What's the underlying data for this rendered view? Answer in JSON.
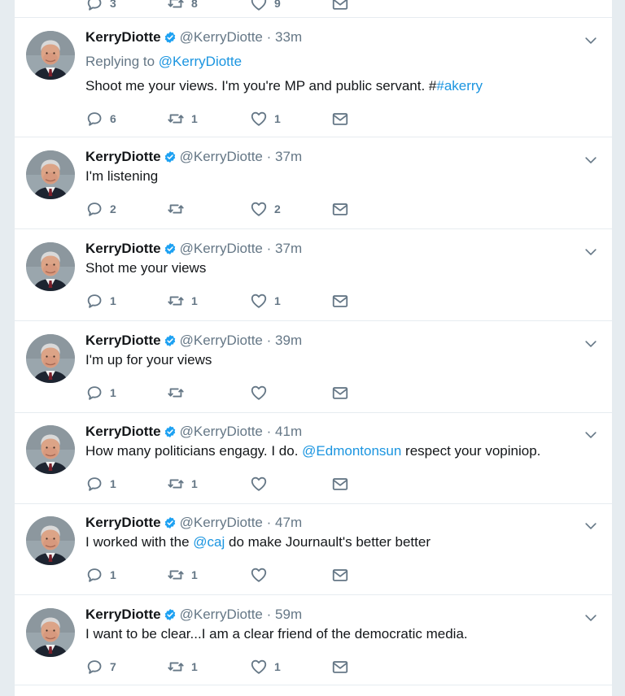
{
  "colors": {
    "link": "#1b95e0",
    "muted": "#657786",
    "verified": "#1da1f2",
    "text": "#14171a",
    "background": "#e6ecf0"
  },
  "partial_tweet": {
    "reply_count": "3",
    "retweet_count": "8",
    "like_count": "9"
  },
  "tweets": [
    {
      "name": "KerryDiotte",
      "handle": "@KerryDiotte",
      "separator": "·",
      "time": "33m",
      "replying_label": "Replying to",
      "replying_handle": "@KerryDiotte",
      "text": "Shoot me your views. I'm you're MP and public servant. #",
      "text_link": "#akerry",
      "text_after": "",
      "reply_count": "6",
      "retweet_count": "1",
      "like_count": "1"
    },
    {
      "name": "KerryDiotte",
      "handle": "@KerryDiotte",
      "separator": "·",
      "time": "37m",
      "text": "I'm listening",
      "text_link": "",
      "text_after": "",
      "reply_count": "2",
      "retweet_count": "",
      "like_count": "2"
    },
    {
      "name": "KerryDiotte",
      "handle": "@KerryDiotte",
      "separator": "·",
      "time": "37m",
      "text": "Shot me your views",
      "text_link": "",
      "text_after": "",
      "reply_count": "1",
      "retweet_count": "1",
      "like_count": "1"
    },
    {
      "name": "KerryDiotte",
      "handle": "@KerryDiotte",
      "separator": "·",
      "time": "39m",
      "text": "I'm up for your views",
      "text_link": "",
      "text_after": "",
      "reply_count": "1",
      "retweet_count": "",
      "like_count": ""
    },
    {
      "name": "KerryDiotte",
      "handle": "@KerryDiotte",
      "separator": "·",
      "time": "41m",
      "text": "How many politicians engagy. I do. ",
      "text_link": "@Edmontonsun",
      "text_after": " respect your vopiniop.",
      "reply_count": "1",
      "retweet_count": "1",
      "like_count": ""
    },
    {
      "name": "KerryDiotte",
      "handle": "@KerryDiotte",
      "separator": "·",
      "time": "47m",
      "text": "I worked with the ",
      "text_link": "@caj",
      "text_after": " do make Journault's better better",
      "reply_count": "1",
      "retweet_count": "1",
      "like_count": ""
    },
    {
      "name": "KerryDiotte",
      "handle": "@KerryDiotte",
      "separator": "·",
      "time": "59m",
      "text": "I want to be clear...I am a clear friend of the democratic media.",
      "text_link": "",
      "text_after": "",
      "reply_count": "7",
      "retweet_count": "1",
      "like_count": "1"
    }
  ]
}
